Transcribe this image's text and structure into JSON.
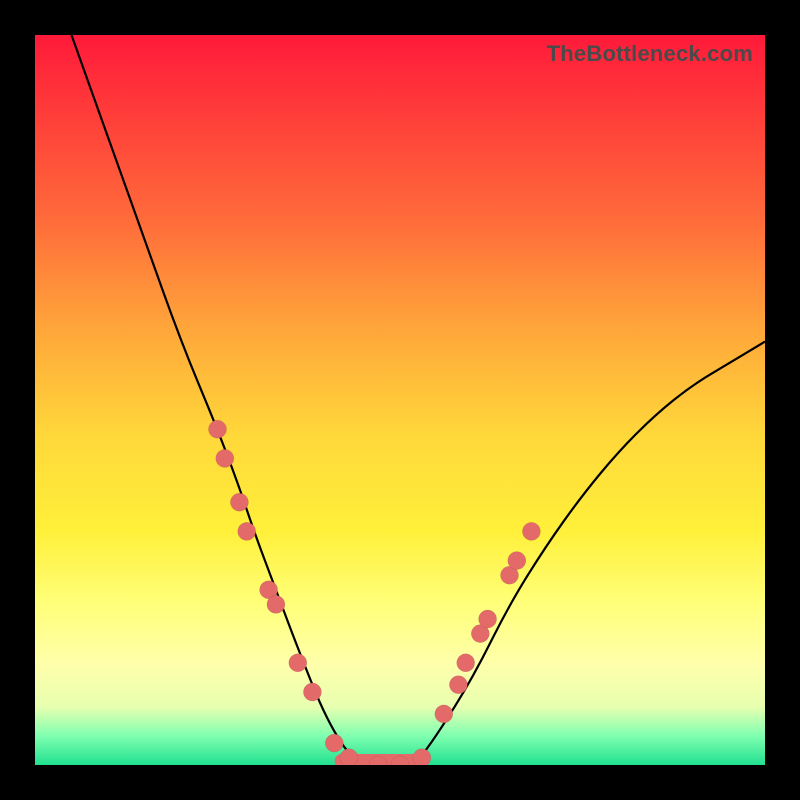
{
  "watermark": "TheBottleneck.com",
  "chart_data": {
    "type": "line",
    "title": "",
    "xlabel": "",
    "ylabel": "",
    "xlim": [
      0,
      100
    ],
    "ylim": [
      0,
      100
    ],
    "grid": false,
    "legend": false,
    "background_gradient": {
      "top": "#ff1a3a",
      "bottom": "#20e090"
    },
    "series": [
      {
        "name": "bottleneck-curve",
        "x": [
          5,
          10,
          15,
          20,
          25,
          28,
          30,
          33,
          36,
          40,
          44,
          48,
          52,
          55,
          60,
          65,
          70,
          75,
          80,
          85,
          90,
          95,
          100
        ],
        "values": [
          100,
          86,
          72,
          58,
          46,
          38,
          32,
          24,
          16,
          6,
          0,
          0,
          0,
          4,
          12,
          22,
          30,
          37,
          43,
          48,
          52,
          55,
          58
        ]
      }
    ],
    "markers_left": [
      {
        "x": 25,
        "y": 46
      },
      {
        "x": 26,
        "y": 42
      },
      {
        "x": 28,
        "y": 36
      },
      {
        "x": 29,
        "y": 32
      },
      {
        "x": 32,
        "y": 24
      },
      {
        "x": 33,
        "y": 22
      },
      {
        "x": 36,
        "y": 14
      },
      {
        "x": 38,
        "y": 10
      }
    ],
    "markers_bottom": [
      {
        "x": 41,
        "y": 3
      },
      {
        "x": 43,
        "y": 1
      },
      {
        "x": 47,
        "y": 0
      },
      {
        "x": 50,
        "y": 0
      },
      {
        "x": 53,
        "y": 1
      }
    ],
    "markers_right": [
      {
        "x": 56,
        "y": 7
      },
      {
        "x": 58,
        "y": 11
      },
      {
        "x": 59,
        "y": 14
      },
      {
        "x": 61,
        "y": 18
      },
      {
        "x": 62,
        "y": 20
      },
      {
        "x": 65,
        "y": 26
      },
      {
        "x": 66,
        "y": 28
      },
      {
        "x": 68,
        "y": 32
      }
    ],
    "flat_segment": {
      "x1": 42,
      "x2": 53,
      "y": 0
    }
  }
}
